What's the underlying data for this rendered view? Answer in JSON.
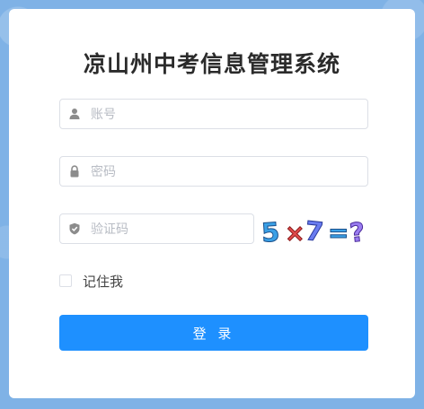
{
  "title": "凉山州中考信息管理系统",
  "form": {
    "account": {
      "placeholder": "账号",
      "value": "",
      "icon": "user-icon"
    },
    "password": {
      "placeholder": "密码",
      "value": "",
      "icon": "lock-icon"
    },
    "captcha": {
      "placeholder": "验证码",
      "value": "",
      "icon": "shield-icon",
      "image_text": "5×7=?"
    },
    "remember": {
      "label": "记住我",
      "checked": false
    },
    "submit_label": "登 录"
  },
  "colors": {
    "background": "#7fb2e6",
    "primary": "#1e90ff",
    "card": "#ffffff"
  }
}
